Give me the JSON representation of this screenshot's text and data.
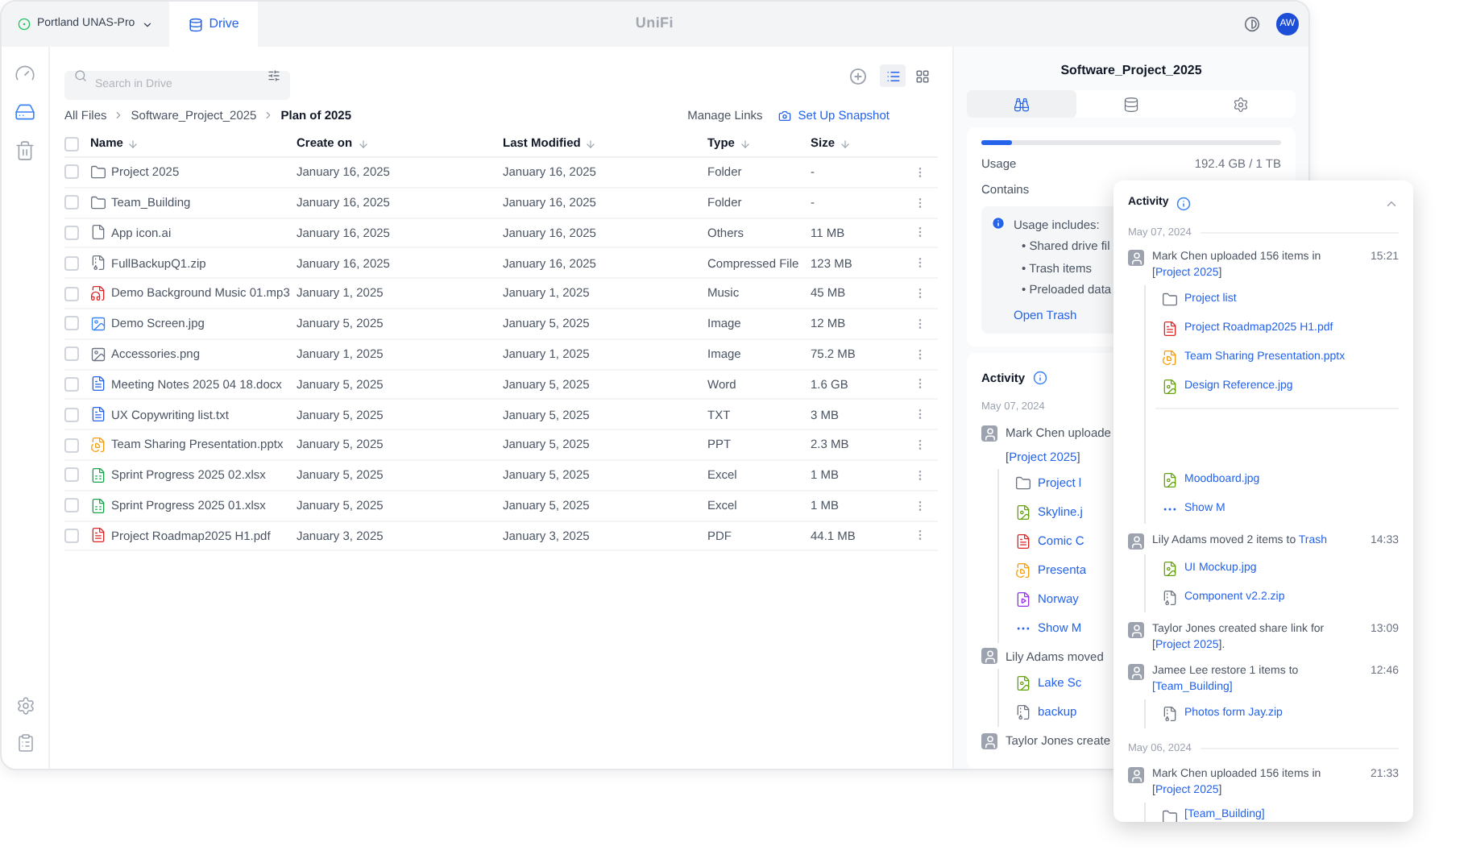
{
  "topbar": {
    "device": "Portland UNAS-Pro",
    "app_tab": {
      "label": "Drive",
      "selected": true
    },
    "brand": "UniFi",
    "avatar": "AW"
  },
  "sidebar": {
    "items": [
      {
        "kind": "dashboard",
        "selected": false
      },
      {
        "kind": "drive",
        "selected": true
      },
      {
        "kind": "trash",
        "selected": false
      }
    ],
    "bottom": [
      {
        "kind": "settings"
      },
      {
        "kind": "logs"
      }
    ]
  },
  "search": {
    "placeholder": "Search in Drive"
  },
  "views": [
    {
      "kind": "list",
      "selected": true
    },
    {
      "kind": "grid",
      "selected": false
    }
  ],
  "breadcrumb": [
    "All Files",
    "Software_Project_2025",
    "Plan of 2025"
  ],
  "actions": {
    "manage_links": "Manage Links",
    "snapshot": "Set Up Snapshot"
  },
  "table": {
    "select_all": {
      "checked": false
    },
    "columns": [
      "Name",
      "Create on",
      "Last Modified",
      "Type",
      "Size"
    ],
    "rows": [
      {
        "kind": "folder",
        "name": "Project 2025",
        "created": "January 16, 2025",
        "modified": "January 16, 2025",
        "type": "Folder",
        "size": "-",
        "checked": false
      },
      {
        "kind": "folder",
        "name": "Team_Building",
        "created": "January 16, 2025",
        "modified": "January 16, 2025",
        "type": "Folder",
        "size": "-",
        "checked": false
      },
      {
        "kind": "file",
        "name": "App icon.ai",
        "created": "January 16, 2025",
        "modified": "January 16, 2025",
        "type": "Others",
        "size": "11 MB",
        "checked": false
      },
      {
        "kind": "zip",
        "name": "FullBackupQ1.zip",
        "created": "January 16, 2025",
        "modified": "January 16, 2025",
        "type": "Compressed File",
        "size": "123 MB",
        "checked": false
      },
      {
        "kind": "music",
        "name": "Demo Background Music 01.mp3",
        "created": "January 1, 2025",
        "modified": "January 1, 2025",
        "type": "Music",
        "size": "45 MB",
        "checked": false
      },
      {
        "kind": "photo",
        "name": "Demo Screen.jpg",
        "created": "January 5, 2025",
        "modified": "January 5, 2025",
        "type": "Image",
        "size": "12 MB",
        "checked": false
      },
      {
        "kind": "thumb",
        "name": "Accessories.png",
        "created": "January 1, 2025",
        "modified": "January 1, 2025",
        "type": "Image",
        "size": "75.2 MB",
        "checked": false
      },
      {
        "kind": "word",
        "name": "Meeting Notes 2025 04 18.docx",
        "created": "January 5, 2025",
        "modified": "January 5, 2025",
        "type": "Word",
        "size": "1.6 GB",
        "checked": false
      },
      {
        "kind": "word",
        "name": "UX Copywriting list.txt",
        "created": "January 5, 2025",
        "modified": "January 5, 2025",
        "type": "TXT",
        "size": "3 MB",
        "checked": false
      },
      {
        "kind": "ppt",
        "name": "Team Sharing Presentation.pptx",
        "created": "January 5, 2025",
        "modified": "January 5, 2025",
        "type": "PPT",
        "size": "2.3 MB",
        "checked": false
      },
      {
        "kind": "excel",
        "name": "Sprint Progress 2025 02.xlsx",
        "created": "January 5, 2025",
        "modified": "January 5, 2025",
        "type": "Excel",
        "size": "1 MB",
        "checked": false
      },
      {
        "kind": "excel",
        "name": "Sprint Progress 2025 01.xlsx",
        "created": "January 5, 2025",
        "modified": "January 5, 2025",
        "type": "Excel",
        "size": "1 MB",
        "checked": false
      },
      {
        "kind": "pdf",
        "name": "Project Roadmap2025 H1.pdf",
        "created": "January 3, 2025",
        "modified": "January 3, 2025",
        "type": "PDF",
        "size": "44.1 MB",
        "checked": false
      }
    ]
  },
  "details": {
    "title": "Software_Project_2025",
    "tabs": [
      {
        "kind": "overview",
        "selected": true
      },
      {
        "kind": "storage",
        "selected": false
      },
      {
        "kind": "settings",
        "selected": false
      }
    ],
    "usage": {
      "label": "Usage",
      "level": 0.1,
      "reading": "192.4 GB / 1 TB"
    },
    "contains": "Contains",
    "note": {
      "title": "Usage includes:",
      "items": [
        "• Shared drive fil",
        "• Trash items",
        "• Preloaded data"
      ],
      "link": "Open Trash"
    },
    "activity": {
      "title": "Activity",
      "date": "May 07, 2024",
      "entries": [
        {
          "parts": [
            {
              "text": "Mark Chen uploade",
              "link": false
            }
          ]
        },
        {
          "parts": [
            {
              "text": "[",
              "link": false
            },
            {
              "text": "Project 2025",
              "link": true
            },
            {
              "text": "]",
              "link": false
            }
          ],
          "children": [
            {
              "kind": "folder",
              "name": "Project l"
            },
            {
              "kind": "image",
              "name": "Skyline.j"
            },
            {
              "kind": "pdf",
              "name": "Comic C"
            },
            {
              "kind": "ppt",
              "name": "Presenta"
            },
            {
              "kind": "video",
              "name": "Norway"
            },
            {
              "kind": "more",
              "name": "Show M"
            }
          ]
        },
        {
          "parts": [
            {
              "text": "Lily Adams moved",
              "link": false
            }
          ],
          "children": [
            {
              "kind": "image",
              "name": "Lake Sc"
            },
            {
              "kind": "zip",
              "name": "backup"
            }
          ]
        },
        {
          "parts": [
            {
              "text": "Taylor Jones create",
              "link": false
            }
          ]
        }
      ]
    }
  },
  "activity_panel": {
    "title": "Activity",
    "expanded": true,
    "groups": [
      {
        "date": "May 07, 2024",
        "entries": [
          {
            "parts": [
              {
                "text": "Mark Chen uploaded 156 items in [",
                "link": false
              },
              {
                "text": "Project 2025",
                "link": true
              },
              {
                "text": "]",
                "link": false
              }
            ],
            "time": "15:21",
            "children": [
              {
                "kind": "folder",
                "name": "Project list"
              },
              {
                "kind": "pdf",
                "name": "Project Roadmap2025 H1.pdf"
              },
              {
                "kind": "ppt",
                "name": "Team Sharing Presentation.pptx"
              },
              {
                "kind": "image",
                "name": "Design Reference.jpg"
              },
              {
                "kind": "gap"
              },
              {
                "kind": "image",
                "name": "Moodboard.jpg"
              },
              {
                "kind": "more",
                "name": "Show M"
              }
            ]
          },
          {
            "parts": [
              {
                "text": "Lily Adams moved 2 items to",
                "link": false
              },
              {
                "text": "Trash",
                "link": true
              }
            ],
            "time": "14:33",
            "children": [
              {
                "kind": "image",
                "name": "UI Mockup.jpg"
              },
              {
                "kind": "zip",
                "name": "Component v2.2.zip"
              }
            ]
          },
          {
            "parts": [
              {
                "text": "Taylor Jones created share link for [",
                "link": false
              },
              {
                "text": "Project 2025",
                "link": true
              },
              {
                "text": "].",
                "link": false
              }
            ],
            "time": "13:09"
          },
          {
            "parts": [
              {
                "text": "Jamee Lee restore 1 items to",
                "link": false
              },
              {
                "text": "[Team_Building]",
                "link": true
              }
            ],
            "time": "12:46",
            "children": [
              {
                "kind": "zip",
                "name": "Photos form Jay.zip"
              }
            ]
          }
        ]
      },
      {
        "date": "May 06, 2024",
        "entries": [
          {
            "parts": [
              {
                "text": "Mark Chen uploaded 156 items in [",
                "link": false
              },
              {
                "text": "Project 2025",
                "link": true
              },
              {
                "text": "]",
                "link": false
              }
            ],
            "time": "21:33",
            "children": [
              {
                "kind": "folder",
                "name": "[Team_Building]"
              }
            ]
          }
        ]
      }
    ]
  }
}
